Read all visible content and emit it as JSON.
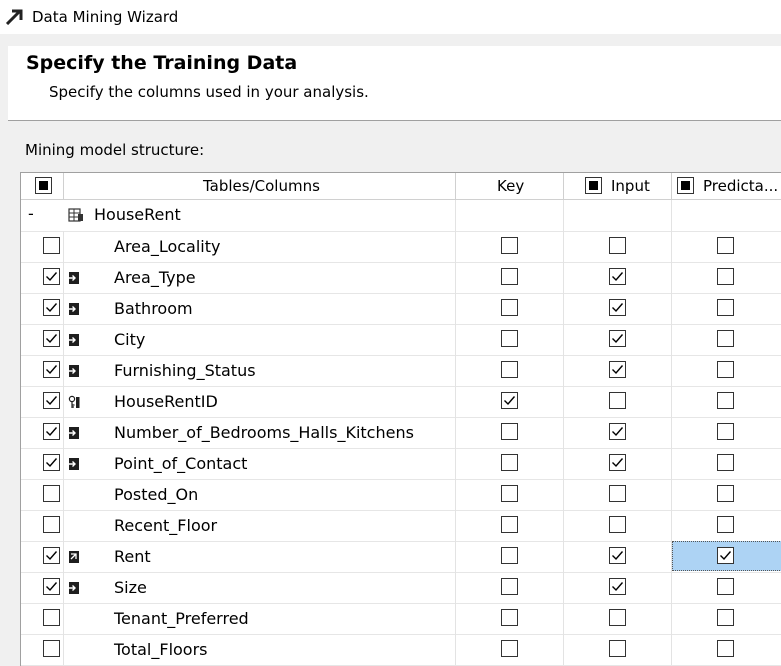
{
  "window": {
    "title": "Data Mining Wizard",
    "icon": "wizard-arrow-icon"
  },
  "header": {
    "title": "Specify the Training Data",
    "subtitle": "Specify the columns used in your analysis."
  },
  "section_label": "Mining model structure:",
  "grid": {
    "columns": {
      "tables_columns": "Tables/Columns",
      "key": "Key",
      "input": "Input",
      "predictable": "Predicta..."
    },
    "table": {
      "name": "HouseRent",
      "collapse_symbol": "-",
      "icon": "table-icon"
    },
    "rows": [
      {
        "name": "Area_Locality",
        "selected": false,
        "icon": "",
        "key": false,
        "input": false,
        "predict": false
      },
      {
        "name": "Area_Type",
        "selected": true,
        "icon": "input-column-icon",
        "key": false,
        "input": true,
        "predict": false
      },
      {
        "name": "Bathroom",
        "selected": true,
        "icon": "input-column-icon",
        "key": false,
        "input": true,
        "predict": false
      },
      {
        "name": "City",
        "selected": true,
        "icon": "input-column-icon",
        "key": false,
        "input": true,
        "predict": false
      },
      {
        "name": "Furnishing_Status",
        "selected": true,
        "icon": "input-column-icon",
        "key": false,
        "input": true,
        "predict": false
      },
      {
        "name": "HouseRentID",
        "selected": true,
        "icon": "key-column-icon",
        "key": true,
        "input": false,
        "predict": false
      },
      {
        "name": "Number_of_Bedrooms_Halls_Kitchens",
        "selected": true,
        "icon": "input-column-icon",
        "key": false,
        "input": true,
        "predict": false
      },
      {
        "name": "Point_of_Contact",
        "selected": true,
        "icon": "input-column-icon",
        "key": false,
        "input": true,
        "predict": false
      },
      {
        "name": "Posted_On",
        "selected": false,
        "icon": "",
        "key": false,
        "input": false,
        "predict": false
      },
      {
        "name": "Recent_Floor",
        "selected": false,
        "icon": "",
        "key": false,
        "input": false,
        "predict": false
      },
      {
        "name": "Rent",
        "selected": true,
        "icon": "predict-column-icon",
        "key": false,
        "input": true,
        "predict": true,
        "highlight": true
      },
      {
        "name": "Size",
        "selected": true,
        "icon": "input-column-icon",
        "key": false,
        "input": true,
        "predict": false
      },
      {
        "name": "Tenant_Preferred",
        "selected": false,
        "icon": "",
        "key": false,
        "input": false,
        "predict": false
      },
      {
        "name": "Total_Floors",
        "selected": false,
        "icon": "",
        "key": false,
        "input": false,
        "predict": false
      }
    ]
  },
  "colors": {
    "selection": "#add3f4",
    "header_border": "#a0a0a0",
    "icon_dark": "#1e1e1e"
  }
}
